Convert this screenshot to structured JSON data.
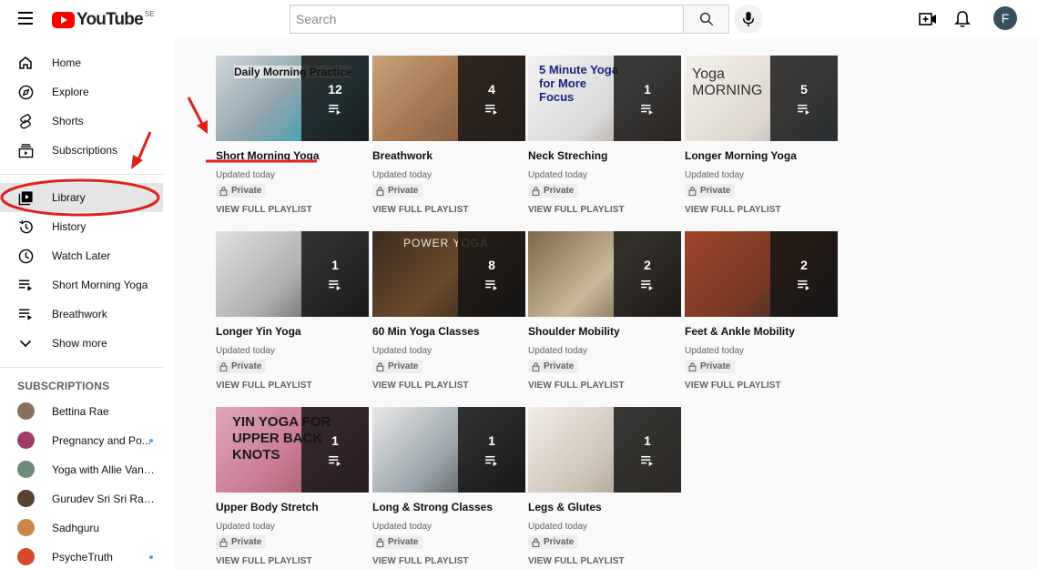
{
  "header": {
    "logo_text": "YouTube",
    "logo_region": "SE",
    "search_placeholder": "Search",
    "avatar_letter": "F"
  },
  "sidebar": {
    "items": [
      {
        "label": "Home",
        "icon": "home-icon"
      },
      {
        "label": "Explore",
        "icon": "compass-icon"
      },
      {
        "label": "Shorts",
        "icon": "shorts-icon"
      },
      {
        "label": "Subscriptions",
        "icon": "subscriptions-icon"
      },
      {
        "label": "Library",
        "icon": "library-icon",
        "active": true
      },
      {
        "label": "History",
        "icon": "history-icon"
      },
      {
        "label": "Watch Later",
        "icon": "clock-icon"
      },
      {
        "label": "Short Morning Yoga",
        "icon": "playlist-icon"
      },
      {
        "label": "Breathwork",
        "icon": "playlist-icon"
      },
      {
        "label": "Show more",
        "icon": "chevron-down-icon"
      }
    ],
    "subscriptions_title": "SUBSCRIPTIONS",
    "subscriptions": [
      {
        "name": "Bettina Rae",
        "avatar_color": "#8a6f5c",
        "new": false
      },
      {
        "name": "Pregnancy and Po...",
        "avatar_color": "#a23a6a",
        "new": true
      },
      {
        "name": "Yoga with Allie Van F...",
        "avatar_color": "#6b8a7a",
        "new": false
      },
      {
        "name": "Gurudev Sri Sri Ravi S...",
        "avatar_color": "#5a4030",
        "new": false
      },
      {
        "name": "Sadhguru",
        "avatar_color": "#c9864a",
        "new": false
      },
      {
        "name": "PsycheTruth",
        "avatar_color": "#d24a2a",
        "new": true
      }
    ]
  },
  "playlists": [
    {
      "title": "Short Morning Yoga",
      "count": "12",
      "updated": "Updated today",
      "privacy": "Private",
      "view_label": "VIEW FULL PLAYLIST",
      "thumb_text": "Daily Morning Practice",
      "bg": "linear-gradient(135deg,#cfd8dc 0%,#90a4ae 45%,#4fa3b0 70%,#37474f 100%)"
    },
    {
      "title": "Breathwork",
      "count": "4",
      "updated": "Updated today",
      "privacy": "Private",
      "view_label": "VIEW FULL PLAYLIST",
      "thumb_text": "",
      "bg": "linear-gradient(135deg,#c8a27a 0%,#a97b54 40%,#6e4a35 100%)"
    },
    {
      "title": "Neck Streching",
      "count": "1",
      "updated": "Updated today",
      "privacy": "Private",
      "view_label": "VIEW FULL PLAYLIST",
      "thumb_text": "5 Minute Yoga for More Focus",
      "bg": "linear-gradient(135deg,#f2f2f2 0%,#d9d9d9 55%,#9a7b6a 100%)"
    },
    {
      "title": "Longer Morning Yoga",
      "count": "5",
      "updated": "Updated today",
      "privacy": "Private",
      "view_label": "VIEW FULL PLAYLIST",
      "thumb_text": "Yoga MORNING",
      "bg": "linear-gradient(135deg,#f4f1ec 0%,#dcd6cc 60%,#8fa6b6 100%)"
    },
    {
      "title": "Longer Yin Yoga",
      "count": "1",
      "updated": "Updated today",
      "privacy": "Private",
      "view_label": "VIEW FULL PLAYLIST",
      "thumb_text": "",
      "bg": "linear-gradient(135deg,#e0e0e0 0%,#b0b0b0 50%,#3a3a3a 100%)"
    },
    {
      "title": "60 Min Yoga Classes",
      "count": "8",
      "updated": "Updated today",
      "privacy": "Private",
      "view_label": "VIEW FULL PLAYLIST",
      "thumb_text": "POWER YOGA",
      "bg": "linear-gradient(135deg,#3a2c20 0%,#6a4a2c 50%,#1e1a16 100%)"
    },
    {
      "title": "Shoulder Mobility",
      "count": "2",
      "updated": "Updated today",
      "privacy": "Private",
      "view_label": "VIEW FULL PLAYLIST",
      "thumb_text": "",
      "bg": "linear-gradient(135deg,#7a6a4a 0%,#c9b89a 50%,#4a3a2a 100%)"
    },
    {
      "title": "Feet & Ankle Mobility",
      "count": "2",
      "updated": "Updated today",
      "privacy": "Private",
      "view_label": "VIEW FULL PLAYLIST",
      "thumb_text": "",
      "bg": "linear-gradient(135deg,#a0452a 0%,#7a3a24 50%,#2a2a2a 100%)"
    },
    {
      "title": "Upper Body Stretch",
      "count": "1",
      "updated": "Updated today",
      "privacy": "Private",
      "view_label": "VIEW FULL PLAYLIST",
      "thumb_text": "YIN YOGA FOR UPPER BACK KNOTS",
      "bg": "linear-gradient(135deg,#e0a6b8 0%,#c97a92 50%,#8a4a5a 100%)"
    },
    {
      "title": "Long & Strong Classes",
      "count": "1",
      "updated": "Updated today",
      "privacy": "Private",
      "view_label": "VIEW FULL PLAYLIST",
      "thumb_text": "",
      "bg": "linear-gradient(135deg,#e8e8e8 0%,#9aa4aa 50%,#2c2c2c 100%)"
    },
    {
      "title": "Legs & Glutes",
      "count": "1",
      "updated": "Updated today",
      "privacy": "Private",
      "view_label": "VIEW FULL PLAYLIST",
      "thumb_text": "",
      "bg": "linear-gradient(135deg,#f0ece6 0%,#cfc6ba 50%,#9a8a7a 100%)"
    }
  ],
  "colors": {
    "annotation_red": "#e0201c",
    "accent_blue": "#3ea6ff"
  }
}
